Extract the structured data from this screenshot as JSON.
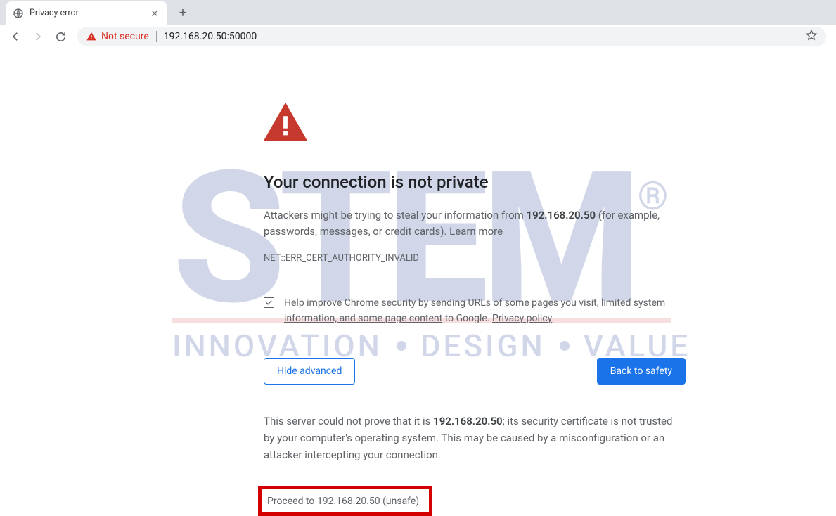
{
  "tab": {
    "title": "Privacy error"
  },
  "omnibox": {
    "security_text": "Not secure",
    "url": "192.168.20.50:50000"
  },
  "page": {
    "heading": "Your connection is not private",
    "desc_lead": "Attackers might be trying to steal your information from ",
    "host": "192.168.20.50",
    "desc_tail": " (for example, passwords, messages, or credit cards). ",
    "learn_more": "Learn more",
    "error_code": "NET::ERR_CERT_AUTHORITY_INVALID",
    "optin_lead": "Help improve Chrome security by sending ",
    "optin_link1": "URLs of some pages you visit, limited system information, and some page content",
    "optin_mid": " to Google. ",
    "optin_link2": "Privacy policy",
    "hide_advanced": "Hide advanced",
    "back_to_safety": "Back to safety",
    "adv_lead": "This server could not prove that it is ",
    "adv_tail": "; its security certificate is not trusted by your computer's operating system. This may be caused by a misconfiguration or an attacker intercepting your connection.",
    "proceed": "Proceed to 192.168.20.50 (unsafe)"
  },
  "watermark": {
    "brand": "STEM",
    "tag1": "INNOVATION",
    "tag2": "DESIGN",
    "tag3": "VALUE"
  }
}
